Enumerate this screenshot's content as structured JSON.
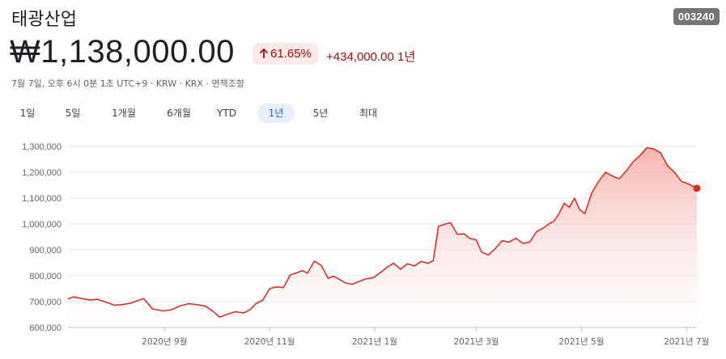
{
  "header": {
    "title": "태광산업",
    "ticker": "003240",
    "price": "₩1,138,000.00",
    "change_pct": "61.65%",
    "change_abs": "+434,000.00 1년",
    "meta": "7월 7일, 오후 6시 0분 1초 UTC+9 · KRW · KRX · 면책조항"
  },
  "colors": {
    "accent_red": "#d93025",
    "badge_bg": "#fce8e6",
    "badge_text": "#a50e0e",
    "active_tab_bg": "#e8f0fe",
    "active_tab_text": "#1967d2"
  },
  "icons": {
    "change_arrow": "arrow-up-icon"
  },
  "tabs": [
    {
      "label": "1일",
      "active": false
    },
    {
      "label": "5일",
      "active": false
    },
    {
      "label": "1개월",
      "active": false
    },
    {
      "label": "6개월",
      "active": false
    },
    {
      "label": "YTD",
      "active": false
    },
    {
      "label": "1년",
      "active": true
    },
    {
      "label": "5년",
      "active": false
    },
    {
      "label": "최대",
      "active": false
    }
  ],
  "chart_data": {
    "type": "area",
    "title": "",
    "xlabel": "",
    "ylabel": "",
    "ylim": [
      600000,
      1300000
    ],
    "yticks": [
      600000,
      700000,
      800000,
      900000,
      1000000,
      1100000,
      1200000,
      1300000
    ],
    "ytick_labels": [
      "600,000",
      "700,000",
      "800,000",
      "900,000",
      "1,000,000",
      "1,100,000",
      "1,200,000",
      "1,300,000"
    ],
    "xlim": [
      "2020-07-07",
      "2021-07-07"
    ],
    "xticks": [
      {
        "date": "2020-09-01",
        "label": "2020년 9월"
      },
      {
        "date": "2020-11-01",
        "label": "2020년 11월"
      },
      {
        "date": "2021-01-01",
        "label": "2021년 1월"
      },
      {
        "date": "2021-03-01",
        "label": "2021년 3월"
      },
      {
        "date": "2021-05-01",
        "label": "2021년 5월"
      },
      {
        "date": "2021-07-01",
        "label": "2021년 7월"
      }
    ],
    "grid": true,
    "series": [
      {
        "color": "#d93025",
        "points": [
          [
            "2020-07-07",
            710000
          ],
          [
            "2020-07-10",
            718000
          ],
          [
            "2020-07-15",
            712000
          ],
          [
            "2020-07-20",
            706000
          ],
          [
            "2020-07-24",
            709000
          ],
          [
            "2020-07-29",
            698000
          ],
          [
            "2020-08-03",
            686000
          ],
          [
            "2020-08-07",
            688000
          ],
          [
            "2020-08-12",
            693000
          ],
          [
            "2020-08-17",
            705000
          ],
          [
            "2020-08-20",
            712000
          ],
          [
            "2020-08-25",
            672000
          ],
          [
            "2020-08-31",
            664000
          ],
          [
            "2020-09-05",
            668000
          ],
          [
            "2020-09-10",
            683000
          ],
          [
            "2020-09-15",
            692000
          ],
          [
            "2020-09-20",
            688000
          ],
          [
            "2020-09-25",
            682000
          ],
          [
            "2020-09-30",
            658000
          ],
          [
            "2020-10-03",
            640000
          ],
          [
            "2020-10-08",
            652000
          ],
          [
            "2020-10-12",
            661000
          ],
          [
            "2020-10-17",
            656000
          ],
          [
            "2020-10-21",
            670000
          ],
          [
            "2020-10-24",
            692000
          ],
          [
            "2020-10-28",
            705000
          ],
          [
            "2020-11-01",
            750000
          ],
          [
            "2020-11-05",
            757000
          ],
          [
            "2020-11-09",
            754000
          ],
          [
            "2020-11-13",
            803000
          ],
          [
            "2020-11-17",
            812000
          ],
          [
            "2020-11-20",
            820000
          ],
          [
            "2020-11-23",
            810000
          ],
          [
            "2020-11-27",
            856000
          ],
          [
            "2020-12-01",
            840000
          ],
          [
            "2020-12-05",
            790000
          ],
          [
            "2020-12-08",
            798000
          ],
          [
            "2020-12-11",
            788000
          ],
          [
            "2020-12-15",
            772000
          ],
          [
            "2020-12-19",
            767000
          ],
          [
            "2020-12-23",
            778000
          ],
          [
            "2020-12-27",
            788000
          ],
          [
            "2020-12-31",
            792000
          ],
          [
            "2021-01-04",
            810000
          ],
          [
            "2021-01-08",
            832000
          ],
          [
            "2021-01-12",
            848000
          ],
          [
            "2021-01-16",
            825000
          ],
          [
            "2021-01-20",
            846000
          ],
          [
            "2021-01-24",
            838000
          ],
          [
            "2021-01-28",
            855000
          ],
          [
            "2021-02-01",
            848000
          ],
          [
            "2021-02-04",
            858000
          ],
          [
            "2021-02-07",
            990000
          ],
          [
            "2021-02-10",
            998000
          ],
          [
            "2021-02-14",
            1005000
          ],
          [
            "2021-02-18",
            960000
          ],
          [
            "2021-02-22",
            962000
          ],
          [
            "2021-02-25",
            945000
          ],
          [
            "2021-03-01",
            938000
          ],
          [
            "2021-03-04",
            892000
          ],
          [
            "2021-03-08",
            880000
          ],
          [
            "2021-03-12",
            905000
          ],
          [
            "2021-03-16",
            935000
          ],
          [
            "2021-03-20",
            930000
          ],
          [
            "2021-03-24",
            945000
          ],
          [
            "2021-03-28",
            925000
          ],
          [
            "2021-04-01",
            930000
          ],
          [
            "2021-04-05",
            970000
          ],
          [
            "2021-04-09",
            985000
          ],
          [
            "2021-04-12",
            1000000
          ],
          [
            "2021-04-15",
            1010000
          ],
          [
            "2021-04-18",
            1040000
          ],
          [
            "2021-04-21",
            1080000
          ],
          [
            "2021-04-24",
            1065000
          ],
          [
            "2021-04-27",
            1100000
          ],
          [
            "2021-04-30",
            1055000
          ],
          [
            "2021-05-03",
            1040000
          ],
          [
            "2021-05-07",
            1120000
          ],
          [
            "2021-05-11",
            1165000
          ],
          [
            "2021-05-15",
            1200000
          ],
          [
            "2021-05-19",
            1185000
          ],
          [
            "2021-05-23",
            1175000
          ],
          [
            "2021-05-27",
            1205000
          ],
          [
            "2021-05-31",
            1240000
          ],
          [
            "2021-06-04",
            1265000
          ],
          [
            "2021-06-08",
            1295000
          ],
          [
            "2021-06-12",
            1290000
          ],
          [
            "2021-06-16",
            1275000
          ],
          [
            "2021-06-20",
            1225000
          ],
          [
            "2021-06-24",
            1200000
          ],
          [
            "2021-06-28",
            1165000
          ],
          [
            "2021-07-02",
            1155000
          ],
          [
            "2021-07-07",
            1138000
          ]
        ]
      }
    ]
  }
}
